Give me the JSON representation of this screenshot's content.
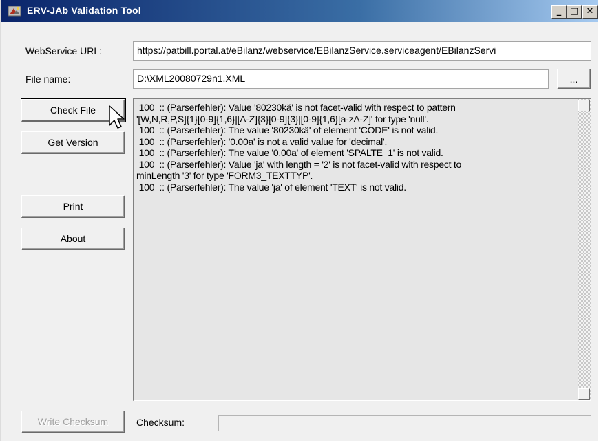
{
  "window": {
    "title": "ERV-JAb Validation Tool",
    "controls": {
      "minimize": "_",
      "maximize": "□",
      "close": "✕"
    }
  },
  "form": {
    "webservice_label": "WebService URL:",
    "webservice_value": "https://patbill.portal.at/eBilanz/webservice/EBilanzService.serviceagent/EBilanzServi",
    "filename_label": "File name:",
    "filename_value": "D:\\XML20080729n1.XML",
    "browse_label": "..."
  },
  "buttons": {
    "check_file": "Check File",
    "get_version": "Get Version",
    "print": "Print",
    "about": "About",
    "write_checksum": "Write Checksum"
  },
  "output_lines": [
    " 100  :: (Parserfehler): Value '80230kä' is not facet-valid with respect to pattern",
    "'[W,N,R,P,S]{1}[0-9]{1,6}|[A-Z]{3}[0-9]{3}|[0-9]{1,6}[a-zA-Z]' for type 'null'.",
    " 100  :: (Parserfehler): The value '80230kä' of element 'CODE' is not valid.",
    " 100  :: (Parserfehler): '0.00a' is not a valid value for 'decimal'.",
    " 100  :: (Parserfehler): The value '0.00a' of element 'SPALTE_1' is not valid.",
    " 100  :: (Parserfehler): Value 'ja' with length = '2' is not facet-valid with respect to",
    "minLength '3' for type 'FORM3_TEXTTYP'.",
    " 100  :: (Parserfehler): The value 'ja' of element 'TEXT' is not valid."
  ],
  "checksum": {
    "label": "Checksum:",
    "value": ""
  },
  "icons": {
    "app": "app-icon",
    "cursor": "mouse-pointer-icon"
  }
}
